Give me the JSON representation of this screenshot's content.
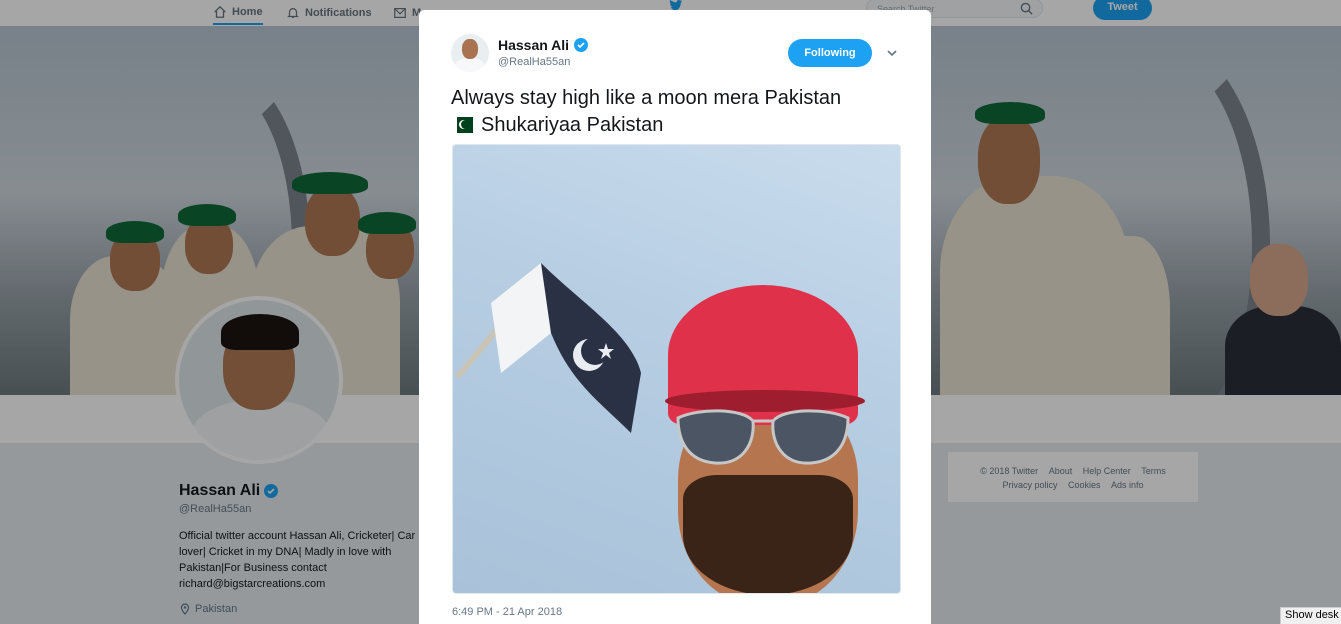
{
  "nav": {
    "home": "Home",
    "notifications": "Notifications",
    "messages": "Messages",
    "search_placeholder": "Search Twitter",
    "tweet_button": "Tweet"
  },
  "profile": {
    "name": "Hassan Ali",
    "handle": "@RealHa55an",
    "bio": "Official twitter account Hassan Ali, Cricketer| Car lover| Cricket in my DNA| Madly in love with Pakistan|For Business contact richard@bigstarcreations.com",
    "location": "Pakistan"
  },
  "footer": {
    "links_row1": [
      "© 2018 Twitter",
      "About",
      "Help Center",
      "Terms"
    ],
    "links_row2": [
      "Privacy policy",
      "Cookies",
      "Ads info"
    ]
  },
  "tweet": {
    "author_name": "Hassan Ali",
    "author_handle": "@RealHa55an",
    "follow_state": "Following",
    "text_line1": "Always stay high like a moon mera Pakistan",
    "text_line2": "Shukariyaa Pakistan",
    "timestamp": "6:49 PM - 21 Apr 2018"
  },
  "taskbar": {
    "show_desktop": "Show desk"
  },
  "colors": {
    "accent": "#1da1f2",
    "background": "#e6ecf0"
  },
  "icons": [
    "home-icon",
    "bell-icon",
    "envelope-icon",
    "twitter-bird-icon",
    "search-icon",
    "verified-badge-icon",
    "chevron-down-icon",
    "location-pin-icon",
    "pakistan-flag-icon"
  ]
}
